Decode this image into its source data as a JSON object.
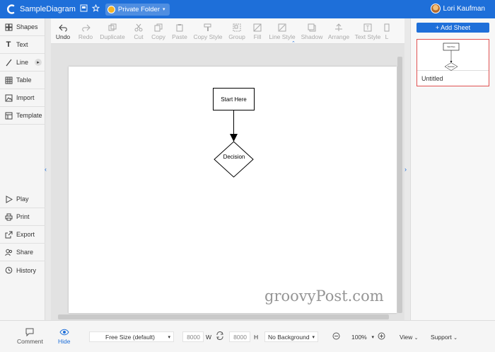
{
  "header": {
    "doc_title": "SampleDiagram",
    "folder_label": "Private Folder",
    "user_name": "Lori Kaufman",
    "accent_color": "#1e6fd9"
  },
  "sidebar": {
    "items": [
      {
        "label": "Shapes",
        "icon": "shapes-icon"
      },
      {
        "label": "Text",
        "icon": "text-icon"
      },
      {
        "label": "Line",
        "icon": "line-icon"
      },
      {
        "label": "Table",
        "icon": "table-icon"
      },
      {
        "label": "Import",
        "icon": "image-import-icon"
      },
      {
        "label": "Template",
        "icon": "template-icon"
      },
      {
        "label": "Play",
        "icon": "play-icon"
      },
      {
        "label": "Print",
        "icon": "print-icon"
      },
      {
        "label": "Export",
        "icon": "export-icon"
      },
      {
        "label": "Share",
        "icon": "share-icon"
      },
      {
        "label": "History",
        "icon": "history-icon"
      }
    ]
  },
  "toolbar": {
    "tools": [
      {
        "label": "Undo",
        "icon": "undo-icon",
        "enabled": true
      },
      {
        "label": "Redo",
        "icon": "redo-icon",
        "enabled": false
      },
      {
        "label": "Duplicate",
        "icon": "duplicate-icon",
        "enabled": false
      },
      {
        "label": "Cut",
        "icon": "cut-icon",
        "enabled": false
      },
      {
        "label": "Copy",
        "icon": "copy-icon",
        "enabled": false
      },
      {
        "label": "Paste",
        "icon": "paste-icon",
        "enabled": false
      },
      {
        "label": "Copy Style",
        "icon": "copy-style-icon",
        "enabled": false
      },
      {
        "label": "Group",
        "icon": "group-icon",
        "enabled": false
      },
      {
        "label": "Fill",
        "icon": "fill-icon",
        "enabled": false
      },
      {
        "label": "Line Style",
        "icon": "line-style-icon",
        "enabled": false
      },
      {
        "label": "Shadow",
        "icon": "shadow-icon",
        "enabled": false
      },
      {
        "label": "Arrange",
        "icon": "arrange-icon",
        "enabled": false
      },
      {
        "label": "Text Style",
        "icon": "text-style-icon",
        "enabled": false
      },
      {
        "label": "L",
        "icon": "more-icon",
        "enabled": false
      }
    ]
  },
  "diagram": {
    "start_label": "Start Here",
    "decision_label": "Decision"
  },
  "watermark": "groovyPost.com",
  "right_panel": {
    "add_sheet_label": "+ Add Sheet",
    "sheet_name": "Untitled",
    "thumb_start_label": "Start Here",
    "thumb_decision_label": "Decision"
  },
  "bottom": {
    "comment_label": "Comment",
    "hide_label": "Hide",
    "page_size": "Free Size (default)",
    "width_value": "8000",
    "width_unit": "W",
    "height_value": "8000",
    "height_unit": "H",
    "background": "No Background",
    "zoom": "100%",
    "view_label": "View",
    "support_label": "Support"
  }
}
